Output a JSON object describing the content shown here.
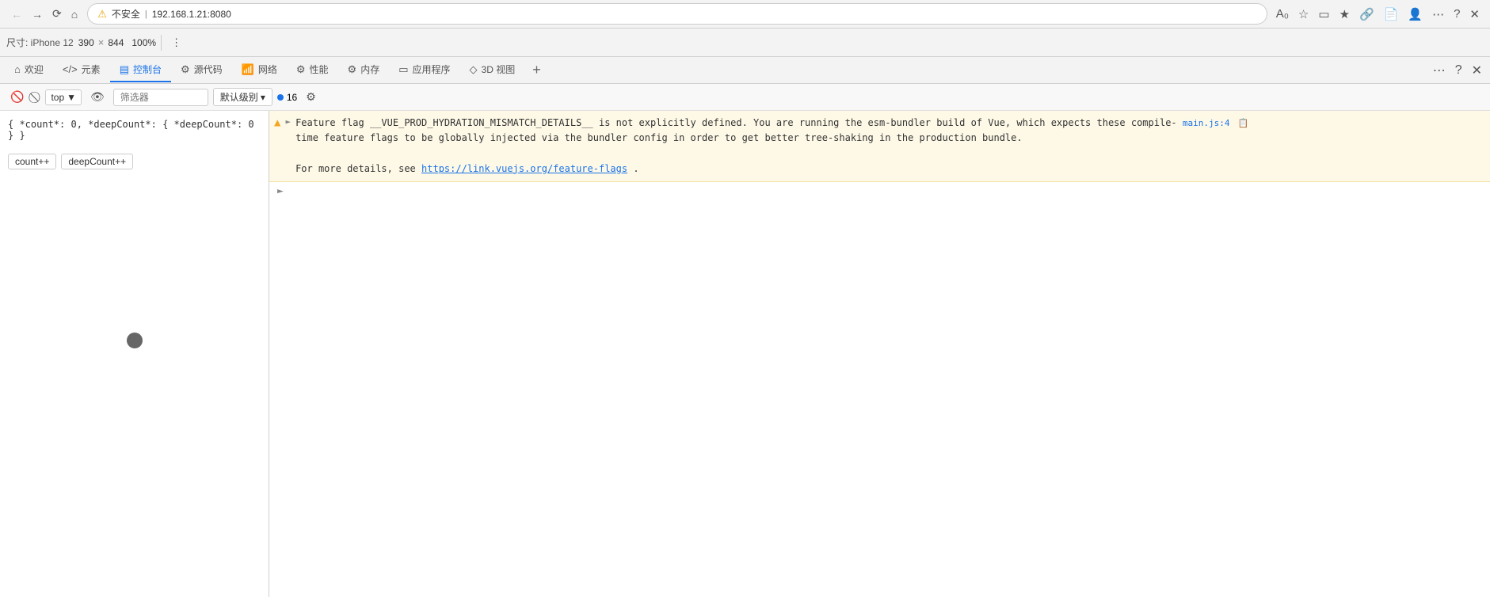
{
  "browser": {
    "address": "192.168.1.21:8080",
    "security_label": "不安全",
    "title": "192.168.1.21:8080"
  },
  "device_toolbar": {
    "size_label": "尺寸: iPhone 12",
    "width": "390",
    "height": "844",
    "zoom": "100%",
    "more_options": "⋮"
  },
  "devtools": {
    "tabs": [
      {
        "id": "welcome",
        "icon": "⌂",
        "label": "欢迎"
      },
      {
        "id": "elements",
        "icon": "</>",
        "label": "元素"
      },
      {
        "id": "console",
        "icon": "▦",
        "label": "控制台",
        "active": true
      },
      {
        "id": "sources",
        "icon": "⚙",
        "label": "源代码"
      },
      {
        "id": "network",
        "icon": "📶",
        "label": "网络"
      },
      {
        "id": "performance",
        "icon": "⚡",
        "label": "性能"
      },
      {
        "id": "memory",
        "icon": "⚙",
        "label": "内存"
      },
      {
        "id": "application",
        "icon": "▭",
        "label": "应用程序"
      },
      {
        "id": "3d-view",
        "icon": "◈",
        "label": "3D 视图"
      }
    ],
    "add_label": "+",
    "more_label": "⋯",
    "help_label": "?",
    "close_label": "✕"
  },
  "console_toolbar": {
    "clear_label": "🚫",
    "clear_btn_label": "⊘",
    "top_label": "top",
    "eye_label": "👁",
    "filter_placeholder": "筛选器",
    "level_label": "默认级别",
    "level_arrow": "▾",
    "count": "16",
    "settings_label": "⚙"
  },
  "console_messages": [
    {
      "type": "warning",
      "icon": "▲",
      "text_part1": "Feature flag __VUE_PROD_HYDRATION_MISMATCH_DETAILS__ is not explicitly defined. You are running the esm-bundler build of Vue, which expects these compile-",
      "text_part2": "time feature flags to be globally injected via the bundler config in order to get better tree-shaking in the production bundle.",
      "text_part3": "For more details, see ",
      "link_text": "https://link.vuejs.org/feature-flags",
      "link_url": "https://link.vuejs.org/feature-flags",
      "text_end": ".",
      "source": "main.js:4",
      "has_expand": true
    }
  ],
  "preview": {
    "json_text": "{ *count*: 0, *deepCount*: { *deepCount*: 0 } }",
    "btn1": "count++",
    "btn2": "deepCount++"
  }
}
